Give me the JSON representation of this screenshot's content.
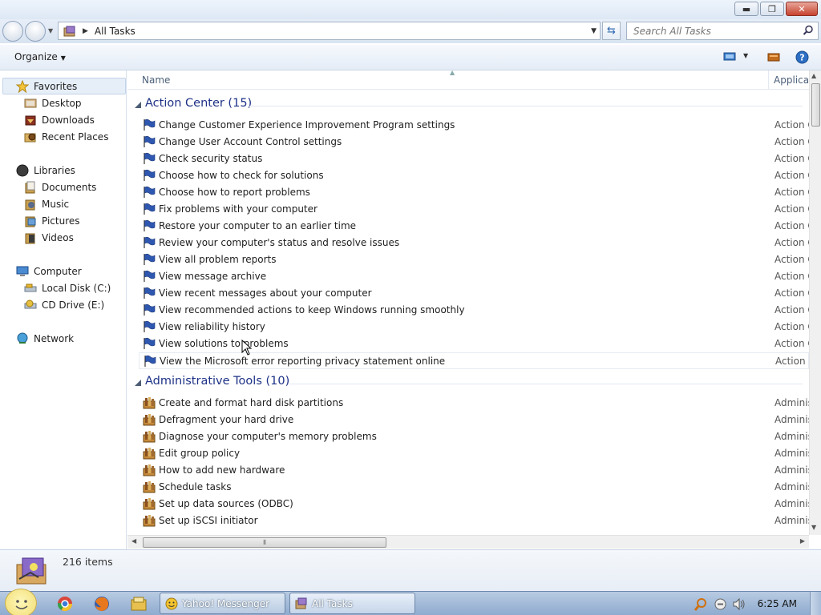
{
  "window": {
    "minimize": "▬",
    "maximize": "❐",
    "close": "✕"
  },
  "address": {
    "path": "All Tasks",
    "search_placeholder": "Search All Tasks"
  },
  "toolbar": {
    "organize_label": "Organize"
  },
  "sidebar": {
    "favorites": "Favorites",
    "desktop": "Desktop",
    "downloads": "Downloads",
    "recent_places": "Recent Places",
    "libraries": "Libraries",
    "documents": "Documents",
    "music": "Music",
    "pictures": "Pictures",
    "videos": "Videos",
    "computer": "Computer",
    "local_disk": "Local Disk (C:)",
    "cd_drive": "CD Drive (E:)",
    "network": "Network"
  },
  "columns": {
    "name": "Name",
    "application": "Applica"
  },
  "groups": {
    "action_center": {
      "title": "Action Center (15)",
      "category": "Action C",
      "items": [
        "Change Customer Experience Improvement Program settings",
        "Change User Account Control settings",
        "Check security status",
        "Choose how to check for solutions",
        "Choose how to report problems",
        "Fix problems with your computer",
        "Restore your computer to an earlier time",
        "Review your computer's status and resolve issues",
        "View all problem reports",
        "View message archive",
        "View recent messages about your computer",
        "View recommended actions to keep Windows running smoothly",
        "View reliability history",
        "View solutions to problems",
        "View the Microsoft error reporting privacy statement online"
      ]
    },
    "admin_tools": {
      "title": "Administrative Tools (10)",
      "category": "Adminis",
      "items": [
        "Create and format hard disk partitions",
        "Defragment your hard drive",
        "Diagnose your computer's memory problems",
        "Edit group policy",
        "How to add new hardware",
        "Schedule tasks",
        "Set up data sources (ODBC)",
        "Set up iSCSI initiator"
      ]
    }
  },
  "status": {
    "item_count": "216 items"
  },
  "taskbar": {
    "yahoo_messenger": "Yahoo! Messenger",
    "all_tasks": "All Tasks",
    "clock": "6:25 AM"
  }
}
